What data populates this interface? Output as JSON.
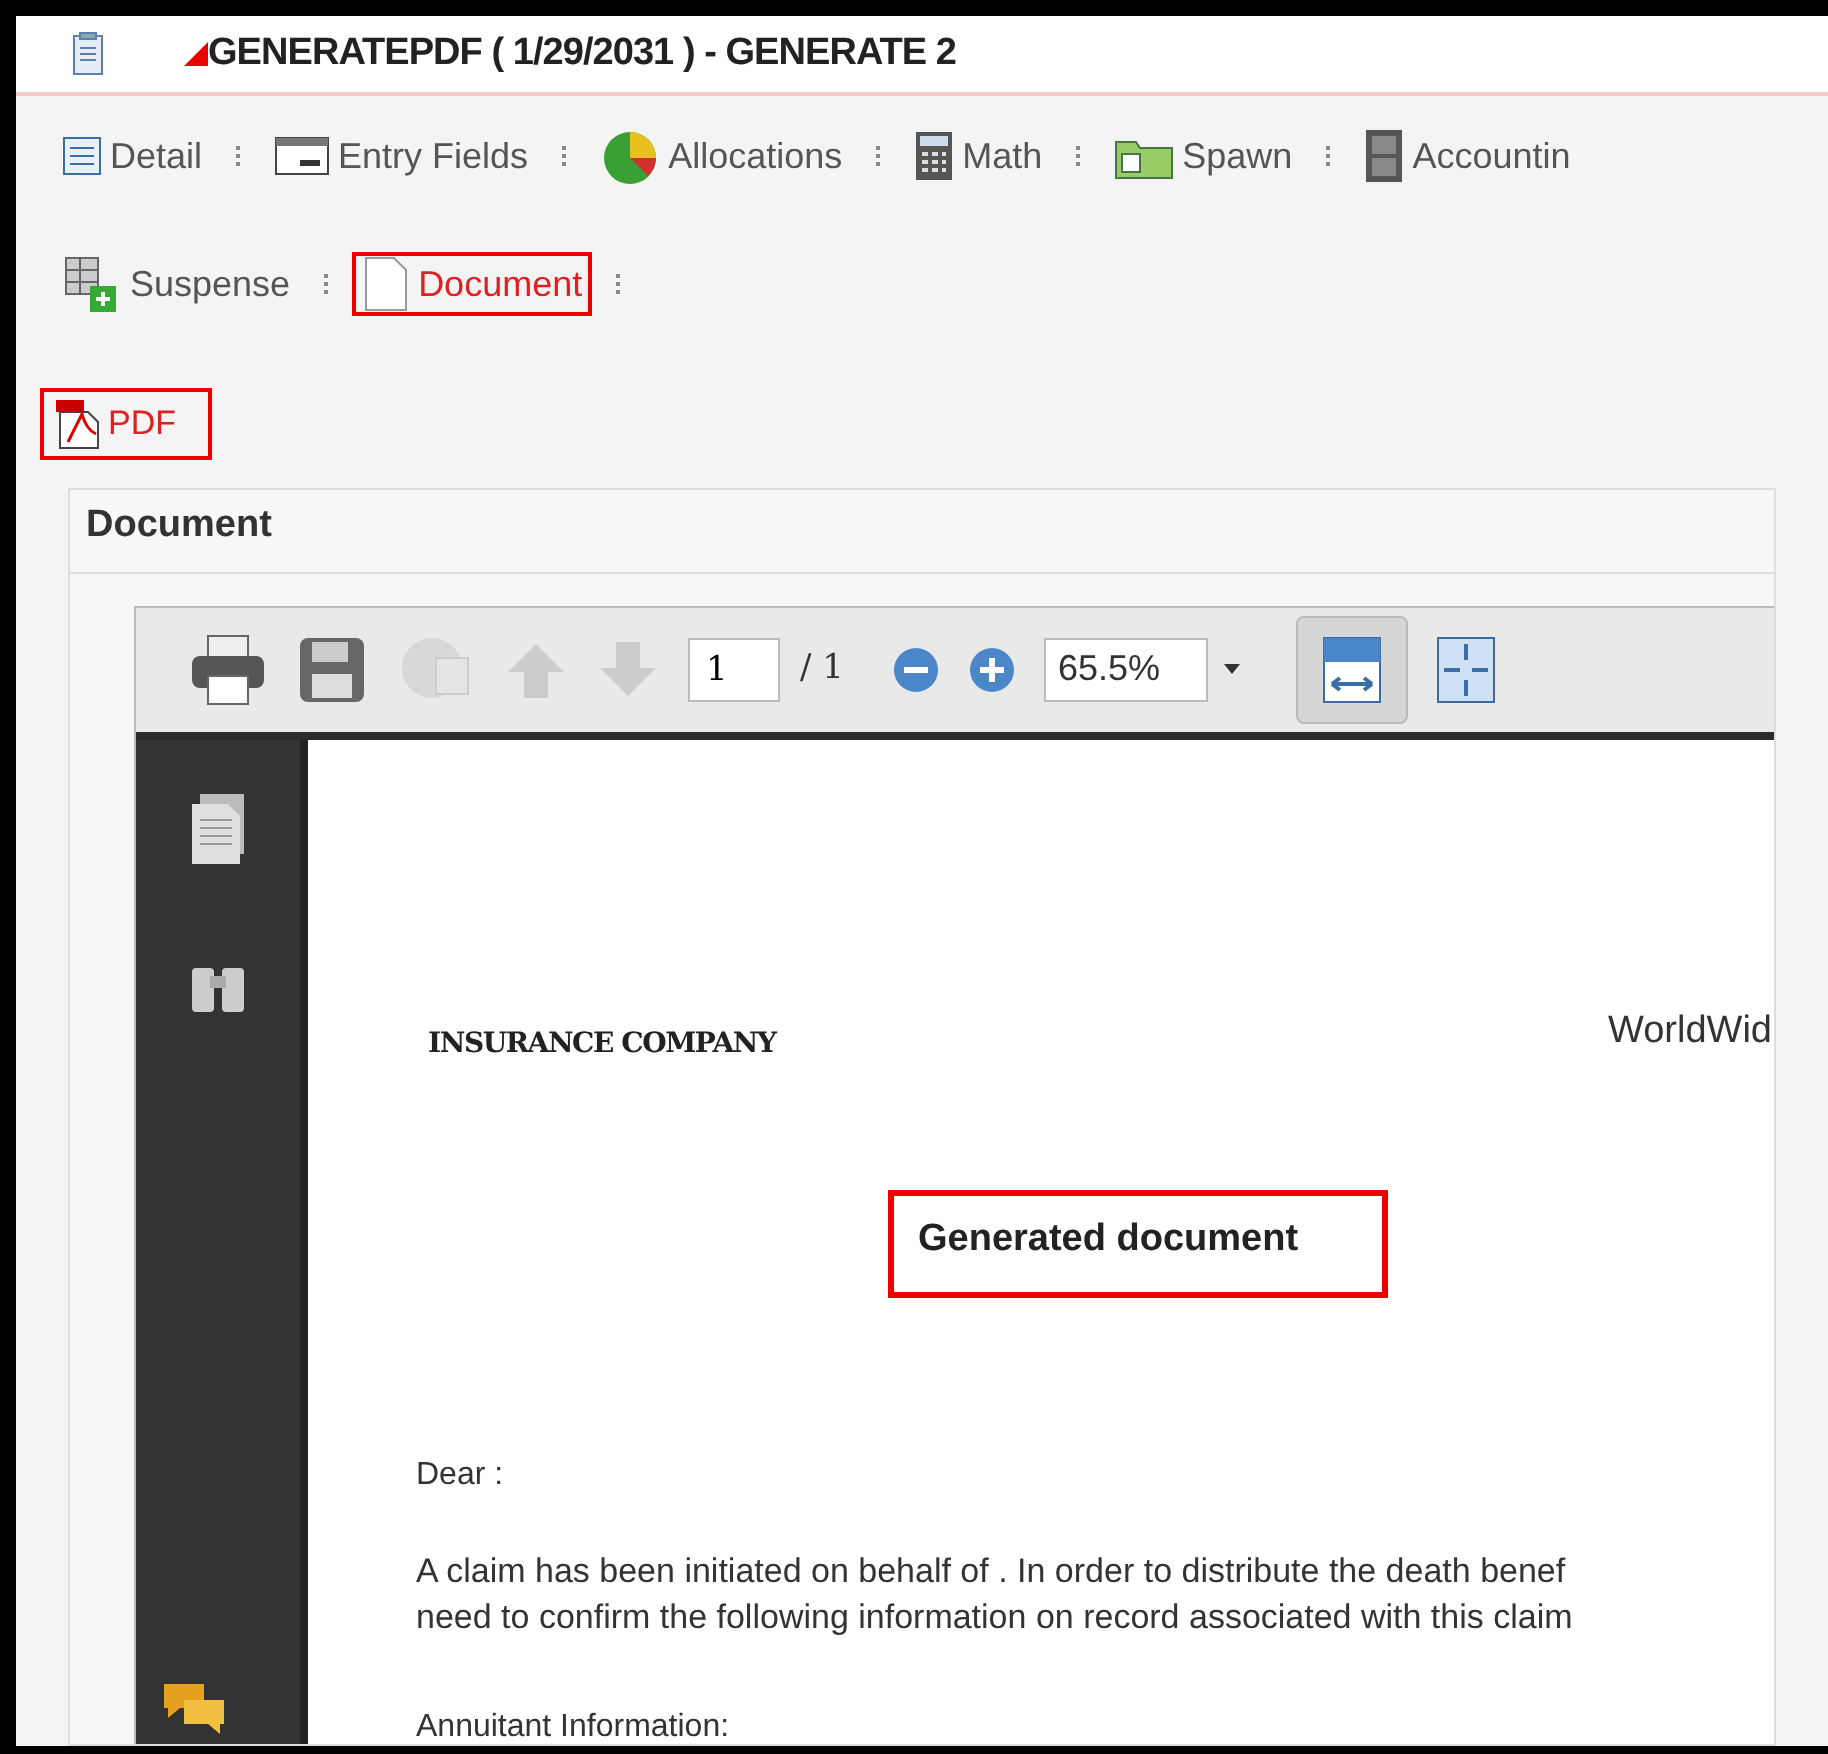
{
  "window": {
    "title": "GENERATEPDF ( 1/29/2031 ) - GENERATE 2"
  },
  "tabs": [
    {
      "label": "Detail",
      "selected": false
    },
    {
      "label": "Entry Fields",
      "selected": false
    },
    {
      "label": "Allocations",
      "selected": false
    },
    {
      "label": "Math",
      "selected": false
    },
    {
      "label": "Spawn",
      "selected": false
    },
    {
      "label": "Accountin",
      "selected": false
    },
    {
      "label": "Suspense",
      "selected": false
    },
    {
      "label": "Document",
      "selected": true
    }
  ],
  "actions": [
    {
      "label": "PDF",
      "selected": true
    }
  ],
  "panel": {
    "title": "Document"
  },
  "viewer": {
    "page": "1",
    "page_total": "/ 1",
    "zoom": "65.5%",
    "fit_width_active": true
  },
  "document": {
    "company": "INSURANCE COMPANY",
    "brand": "WorldWid",
    "heading": "Generated document",
    "heading_highlighted": true,
    "greeting": "Dear :",
    "body": [
      "A claim has been initiated on behalf of  . In order to distribute the death benef",
      "need to confirm the following information on record associated with this claim"
    ],
    "section": "Annuitant Information:"
  }
}
